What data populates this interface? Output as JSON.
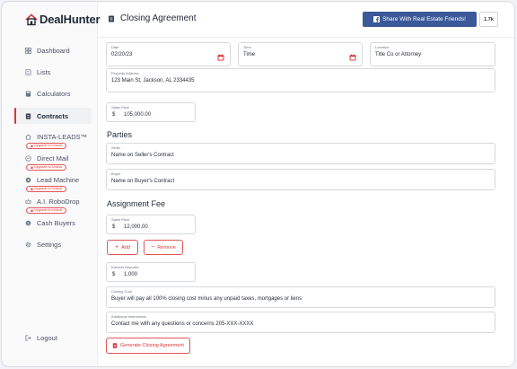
{
  "brand": {
    "name": "DealHunter"
  },
  "sidebar": {
    "items": [
      {
        "label": "Dashboard"
      },
      {
        "label": "Lists"
      },
      {
        "label": "Calculators"
      },
      {
        "label": "Contracts"
      },
      {
        "label": "INSTA-LEADS™"
      },
      {
        "label": "Direct Mail"
      },
      {
        "label": "Lead Machine"
      },
      {
        "label": "A.I. RoboDrop"
      },
      {
        "label": "Cash Buyers"
      },
      {
        "label": "Settings"
      }
    ],
    "upgrade_badge": "Upgrade to Unlock",
    "logout": "Logout"
  },
  "header": {
    "title": "Closing Agreement",
    "share_label": "Share With Real Estate Friends!",
    "share_count": "1.7k"
  },
  "form": {
    "date": {
      "label": "Date",
      "value": "02/20/23"
    },
    "time": {
      "label": "Time",
      "value": "Time"
    },
    "location": {
      "label": "Location",
      "value": "Title Co or Attorney"
    },
    "property_address": {
      "label": "Property Address",
      "value": "123 Main St, Jackson, AL 2334435"
    },
    "sales_price": {
      "label": "Sales Price",
      "currency": "$",
      "value": "105,000.00"
    },
    "parties_title": "Parties",
    "seller": {
      "label": "Seller",
      "value": "Name on Seller's Contract"
    },
    "buyer": {
      "label": "Buyer",
      "value": "Name on Buyer's Contract"
    },
    "assignment_title": "Assignment Fee",
    "assignment_price": {
      "label": "Sales Price",
      "currency": "$",
      "value": "12,000,00"
    },
    "add_label": "Add",
    "remove_label": "Remove",
    "earnest_deposits": {
      "label": "Earnest Deposits",
      "currency": "$",
      "value": "1,000"
    },
    "closing_cost": {
      "label": "Closing Cost",
      "value": "Buyer will pay all 100% closing cost minus any unpaid taxes, mortgages or liens"
    },
    "additional_instructions": {
      "label": "Additional Instructions",
      "value": "Contact me with any questions or concerns 205-XXX-XXXX"
    },
    "generate_label": "Generate Closing Agreement"
  },
  "colors": {
    "accent": "#d93838",
    "facebook": "#3b5998"
  }
}
